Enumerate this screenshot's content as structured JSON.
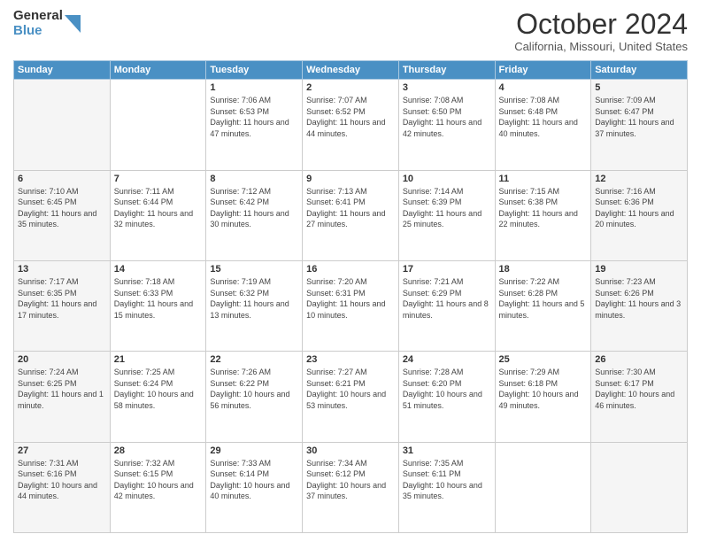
{
  "logo": {
    "general": "General",
    "blue": "Blue"
  },
  "header": {
    "month": "October 2024",
    "location": "California, Missouri, United States"
  },
  "weekdays": [
    "Sunday",
    "Monday",
    "Tuesday",
    "Wednesday",
    "Thursday",
    "Friday",
    "Saturday"
  ],
  "weeks": [
    [
      {
        "day": "",
        "info": ""
      },
      {
        "day": "",
        "info": ""
      },
      {
        "day": "1",
        "info": "Sunrise: 7:06 AM\nSunset: 6:53 PM\nDaylight: 11 hours and 47 minutes."
      },
      {
        "day": "2",
        "info": "Sunrise: 7:07 AM\nSunset: 6:52 PM\nDaylight: 11 hours and 44 minutes."
      },
      {
        "day": "3",
        "info": "Sunrise: 7:08 AM\nSunset: 6:50 PM\nDaylight: 11 hours and 42 minutes."
      },
      {
        "day": "4",
        "info": "Sunrise: 7:08 AM\nSunset: 6:48 PM\nDaylight: 11 hours and 40 minutes."
      },
      {
        "day": "5",
        "info": "Sunrise: 7:09 AM\nSunset: 6:47 PM\nDaylight: 11 hours and 37 minutes."
      }
    ],
    [
      {
        "day": "6",
        "info": "Sunrise: 7:10 AM\nSunset: 6:45 PM\nDaylight: 11 hours and 35 minutes."
      },
      {
        "day": "7",
        "info": "Sunrise: 7:11 AM\nSunset: 6:44 PM\nDaylight: 11 hours and 32 minutes."
      },
      {
        "day": "8",
        "info": "Sunrise: 7:12 AM\nSunset: 6:42 PM\nDaylight: 11 hours and 30 minutes."
      },
      {
        "day": "9",
        "info": "Sunrise: 7:13 AM\nSunset: 6:41 PM\nDaylight: 11 hours and 27 minutes."
      },
      {
        "day": "10",
        "info": "Sunrise: 7:14 AM\nSunset: 6:39 PM\nDaylight: 11 hours and 25 minutes."
      },
      {
        "day": "11",
        "info": "Sunrise: 7:15 AM\nSunset: 6:38 PM\nDaylight: 11 hours and 22 minutes."
      },
      {
        "day": "12",
        "info": "Sunrise: 7:16 AM\nSunset: 6:36 PM\nDaylight: 11 hours and 20 minutes."
      }
    ],
    [
      {
        "day": "13",
        "info": "Sunrise: 7:17 AM\nSunset: 6:35 PM\nDaylight: 11 hours and 17 minutes."
      },
      {
        "day": "14",
        "info": "Sunrise: 7:18 AM\nSunset: 6:33 PM\nDaylight: 11 hours and 15 minutes."
      },
      {
        "day": "15",
        "info": "Sunrise: 7:19 AM\nSunset: 6:32 PM\nDaylight: 11 hours and 13 minutes."
      },
      {
        "day": "16",
        "info": "Sunrise: 7:20 AM\nSunset: 6:31 PM\nDaylight: 11 hours and 10 minutes."
      },
      {
        "day": "17",
        "info": "Sunrise: 7:21 AM\nSunset: 6:29 PM\nDaylight: 11 hours and 8 minutes."
      },
      {
        "day": "18",
        "info": "Sunrise: 7:22 AM\nSunset: 6:28 PM\nDaylight: 11 hours and 5 minutes."
      },
      {
        "day": "19",
        "info": "Sunrise: 7:23 AM\nSunset: 6:26 PM\nDaylight: 11 hours and 3 minutes."
      }
    ],
    [
      {
        "day": "20",
        "info": "Sunrise: 7:24 AM\nSunset: 6:25 PM\nDaylight: 11 hours and 1 minute."
      },
      {
        "day": "21",
        "info": "Sunrise: 7:25 AM\nSunset: 6:24 PM\nDaylight: 10 hours and 58 minutes."
      },
      {
        "day": "22",
        "info": "Sunrise: 7:26 AM\nSunset: 6:22 PM\nDaylight: 10 hours and 56 minutes."
      },
      {
        "day": "23",
        "info": "Sunrise: 7:27 AM\nSunset: 6:21 PM\nDaylight: 10 hours and 53 minutes."
      },
      {
        "day": "24",
        "info": "Sunrise: 7:28 AM\nSunset: 6:20 PM\nDaylight: 10 hours and 51 minutes."
      },
      {
        "day": "25",
        "info": "Sunrise: 7:29 AM\nSunset: 6:18 PM\nDaylight: 10 hours and 49 minutes."
      },
      {
        "day": "26",
        "info": "Sunrise: 7:30 AM\nSunset: 6:17 PM\nDaylight: 10 hours and 46 minutes."
      }
    ],
    [
      {
        "day": "27",
        "info": "Sunrise: 7:31 AM\nSunset: 6:16 PM\nDaylight: 10 hours and 44 minutes."
      },
      {
        "day": "28",
        "info": "Sunrise: 7:32 AM\nSunset: 6:15 PM\nDaylight: 10 hours and 42 minutes."
      },
      {
        "day": "29",
        "info": "Sunrise: 7:33 AM\nSunset: 6:14 PM\nDaylight: 10 hours and 40 minutes."
      },
      {
        "day": "30",
        "info": "Sunrise: 7:34 AM\nSunset: 6:12 PM\nDaylight: 10 hours and 37 minutes."
      },
      {
        "day": "31",
        "info": "Sunrise: 7:35 AM\nSunset: 6:11 PM\nDaylight: 10 hours and 35 minutes."
      },
      {
        "day": "",
        "info": ""
      },
      {
        "day": "",
        "info": ""
      }
    ]
  ]
}
